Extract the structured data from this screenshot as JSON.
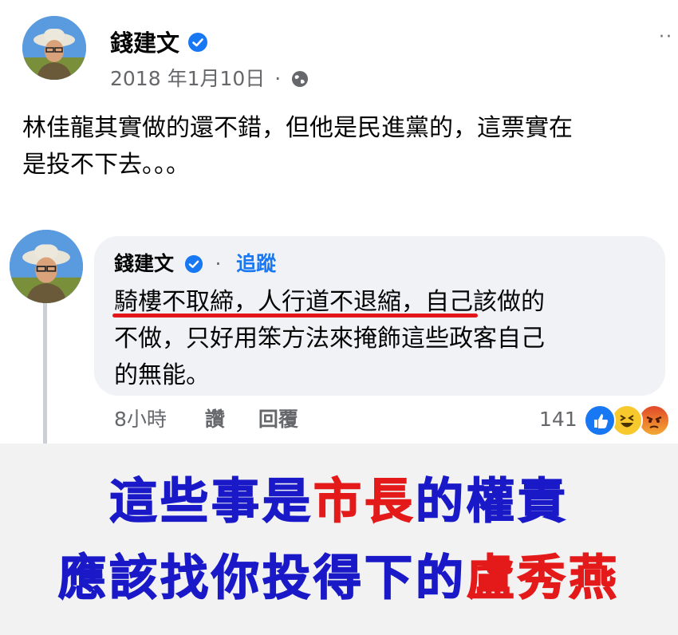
{
  "post": {
    "author": "錢建文",
    "date": "2018 年1月10日",
    "meta_sep": "·",
    "more": "··",
    "text_line1": "林佳龍其實做的還不錯，但他是民進黨的，這票實在",
    "text_line2": "是投不下去。。。"
  },
  "comment": {
    "author": "錢建文",
    "dot": "·",
    "follow": "追蹤",
    "line1_underlined": "騎樓不取締，人行道不退縮",
    "line1_rest": "，自己該做的",
    "line2": "不做，只好用笨方法來掩飾這些政客自己",
    "line3": "的無能。",
    "time": "8小時",
    "like_label": "讚",
    "reply_label": "回覆",
    "reaction_count": "141"
  },
  "banner": {
    "line1_part1": "這些事是",
    "line1_part2": "市長",
    "line1_part3": "的權責",
    "line2_part1": "應該找你投得下的",
    "line2_part2": "盧秀燕"
  },
  "colors": {
    "facebook_blue": "#1877f2",
    "banner_blue": "#1a19c8",
    "banner_red": "#e41a1a",
    "underline_red": "#e4161b",
    "bubble_bg": "#f0f2f5"
  },
  "icons": [
    "verified-badge-icon",
    "globe-icon",
    "like-reaction-icon",
    "haha-reaction-icon",
    "angry-reaction-icon"
  ]
}
